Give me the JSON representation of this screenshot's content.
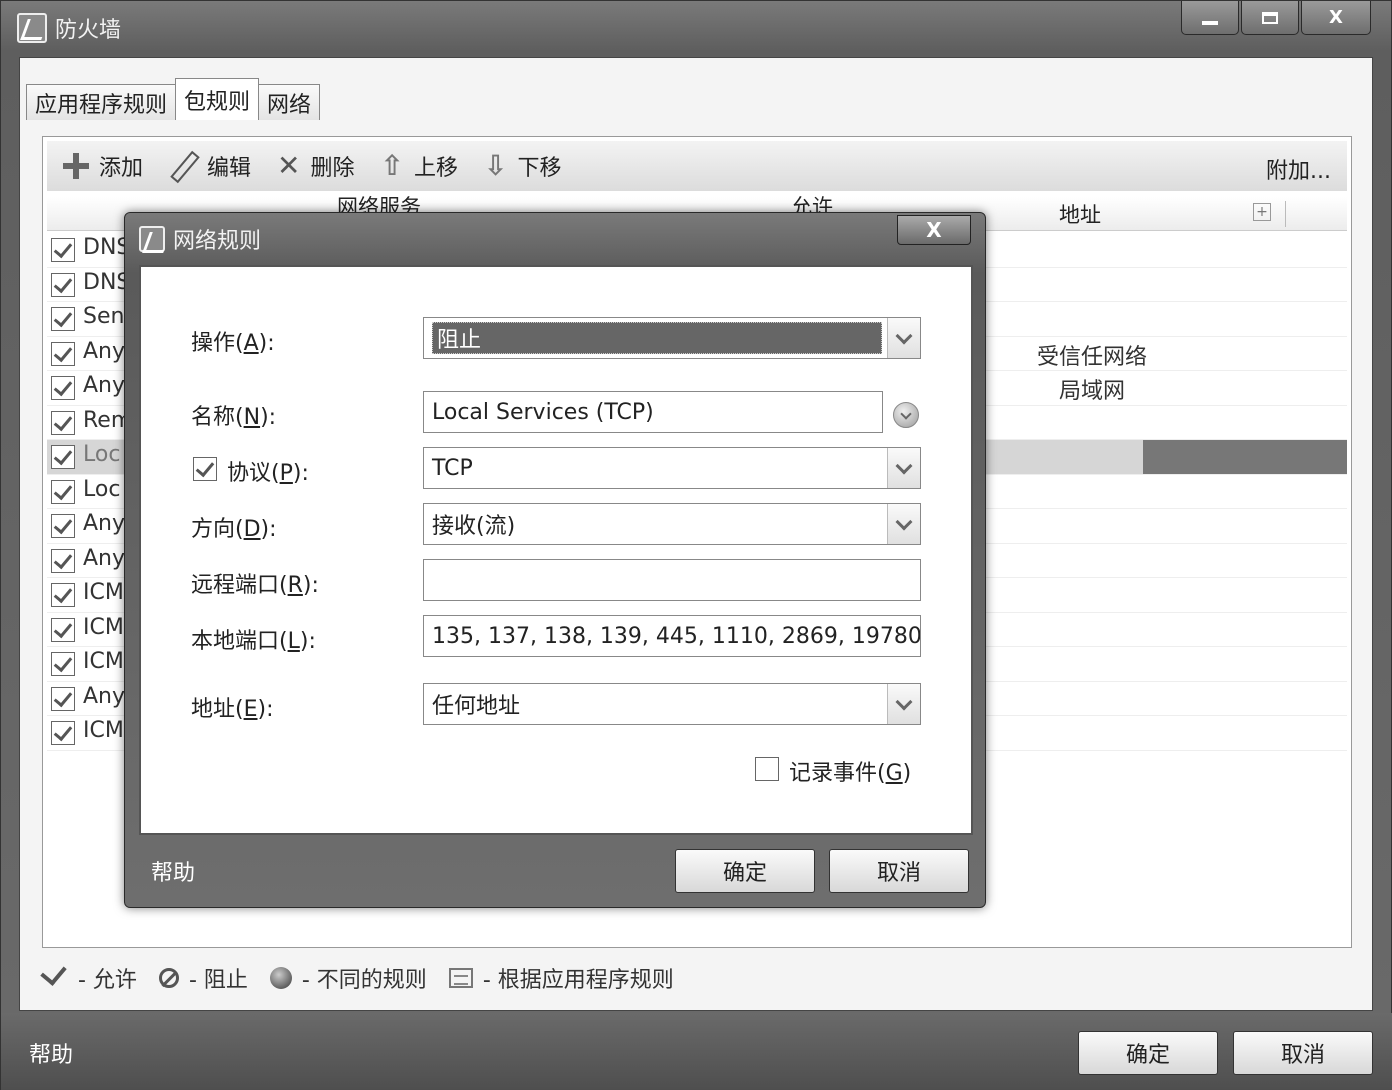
{
  "window": {
    "title": "防火墙",
    "controls": [
      "minimize",
      "maximize",
      "X"
    ]
  },
  "tabs": [
    {
      "label": "应用程序规则"
    },
    {
      "label": "包规则"
    },
    {
      "label": "网络"
    }
  ],
  "toolbar": {
    "add": "添加",
    "edit": "编辑",
    "delete": "删除",
    "move_up": "上移",
    "move_down": "下移",
    "more": "附加..."
  },
  "grid": {
    "columns": {
      "name": "网络服务",
      "action": "允许",
      "address": "地址"
    },
    "rows": [
      {
        "name": "DNS",
        "address": ""
      },
      {
        "name": "DNS",
        "address": ""
      },
      {
        "name": "Sen",
        "address": ""
      },
      {
        "name": "Any",
        "address": "受信任网络"
      },
      {
        "name": "Any",
        "address": "局域网"
      },
      {
        "name": "Rem",
        "address": ""
      },
      {
        "name": "Loc",
        "address": ""
      },
      {
        "name": "Loc",
        "address": ""
      },
      {
        "name": "Any",
        "address": ""
      },
      {
        "name": "Any",
        "address": ""
      },
      {
        "name": "ICM",
        "address": ""
      },
      {
        "name": "ICM",
        "address": ""
      },
      {
        "name": "ICM",
        "address": ""
      },
      {
        "name": "Any",
        "address": ""
      },
      {
        "name": "ICM",
        "address": ""
      }
    ]
  },
  "legend": {
    "allow": "- 允许",
    "block": "- 阻止",
    "diff": "- 不同的规则",
    "app": "- 根据应用程序规则"
  },
  "footer": {
    "help": "帮助",
    "ok": "确定",
    "cancel": "取消"
  },
  "dialog": {
    "title": "网络规则",
    "close": "X",
    "action_label": "操作(",
    "action_key": "A",
    "action_value": "阻止",
    "name_label": "名称(",
    "name_key": "N",
    "name_value": "Local Services (TCP)",
    "protocol_label": "协议(",
    "protocol_key": "P",
    "protocol_value": "TCP",
    "direction_label": "方向(",
    "direction_key": "D",
    "direction_value": "接收(流)",
    "remote_port_label": "远程端口(",
    "remote_port_key": "R",
    "remote_port_value": "",
    "local_port_label": "本地端口(",
    "local_port_key": "L",
    "local_port_value": "135, 137, 138, 139, 445, 1110, 2869, 19780",
    "address_label": "地址(",
    "address_key": "E",
    "address_value": "任何地址",
    "log_label": "记录事件(",
    "log_key": "G",
    "log_suffix": ")",
    "label_suffix": "):",
    "help": "帮助",
    "ok": "确定",
    "cancel": "取消"
  }
}
